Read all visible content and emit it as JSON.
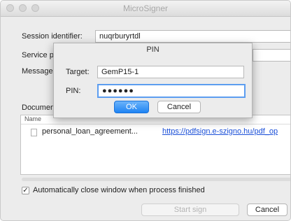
{
  "window": {
    "title": "MicroSigner"
  },
  "form": {
    "session_label": "Session identifier:",
    "session_value": "nuqrburyrtdl",
    "service_label": "Service p",
    "message_label": "Message",
    "documents_label": "Documen"
  },
  "documents": {
    "column_name": "Name",
    "rows": [
      {
        "name": "personal_loan_agreement...",
        "url": "https://pdfsign.e-szigno.hu/pdf_op"
      }
    ]
  },
  "options": {
    "auto_close_label": "Automatically close window when process finished",
    "auto_close_checked": "✓"
  },
  "buttons": {
    "start_sign": "Start sign",
    "cancel": "Cancel"
  },
  "pin_dialog": {
    "title": "PIN",
    "target_label": "Target:",
    "target_value": "GemP15-1",
    "pin_label": "PIN:",
    "pin_value": "●●●●●●",
    "ok": "OK",
    "cancel": "Cancel"
  }
}
